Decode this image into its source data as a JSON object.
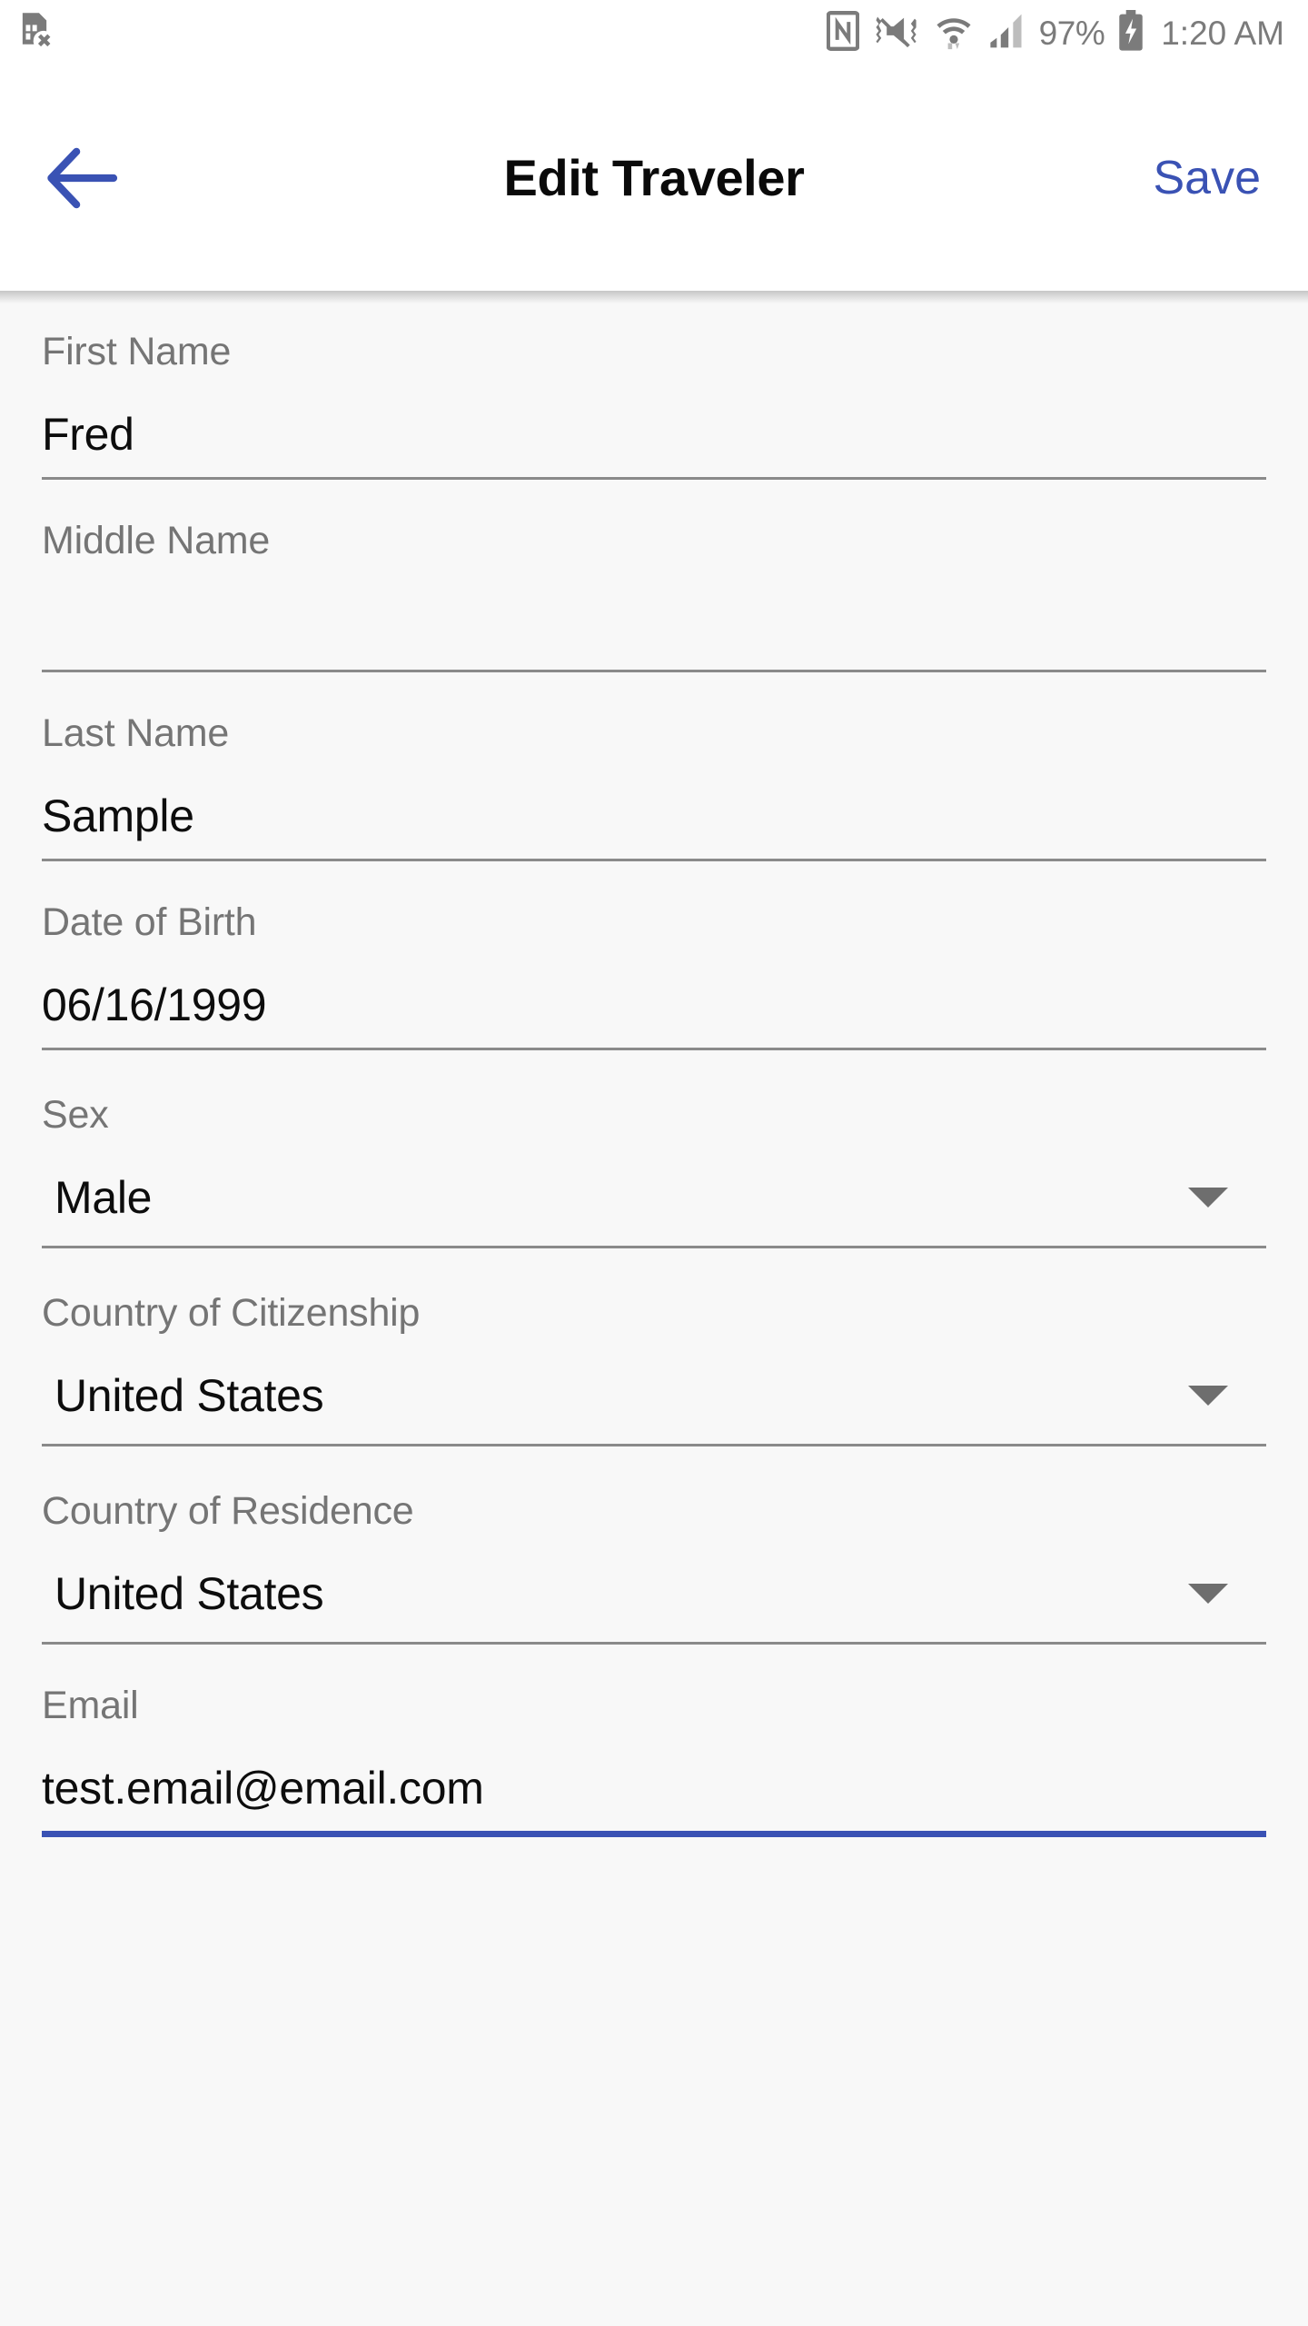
{
  "status_bar": {
    "icons": [
      "sim-card-missing-icon",
      "nfc-icon",
      "vibrate-mute-icon",
      "wifi-icon",
      "cellular-signal-icon",
      "battery-charging-icon"
    ],
    "battery_percent": "97%",
    "clock": "1:20 AM"
  },
  "app_bar": {
    "back_label": "back-arrow",
    "title": "Edit Traveler",
    "save_label": "Save",
    "accent_color": "#3a52b4"
  },
  "form": {
    "fields": [
      {
        "label": "First Name",
        "value": "Fred",
        "type": "text",
        "focused": false
      },
      {
        "label": "Middle Name",
        "value": "",
        "type": "text",
        "focused": false
      },
      {
        "label": "Last Name",
        "value": "Sample",
        "type": "text",
        "focused": false
      },
      {
        "label": "Date of Birth",
        "value": "06/16/1999",
        "type": "text",
        "focused": false
      },
      {
        "label": "Sex",
        "value": "Male",
        "type": "select",
        "focused": false
      },
      {
        "label": "Country of Citizenship",
        "value": "United States",
        "type": "select",
        "focused": false
      },
      {
        "label": "Country of Residence",
        "value": "United States",
        "type": "select",
        "focused": false
      },
      {
        "label": "Email",
        "value": "test.email@email.com",
        "type": "text",
        "focused": true
      }
    ]
  },
  "colors": {
    "label": "#757575",
    "value": "#0d0d0d",
    "underline": "#8a8a8a",
    "focus_underline": "#3a52b4",
    "background": "#f8f8f8",
    "app_bar_bg": "#ffffff"
  }
}
